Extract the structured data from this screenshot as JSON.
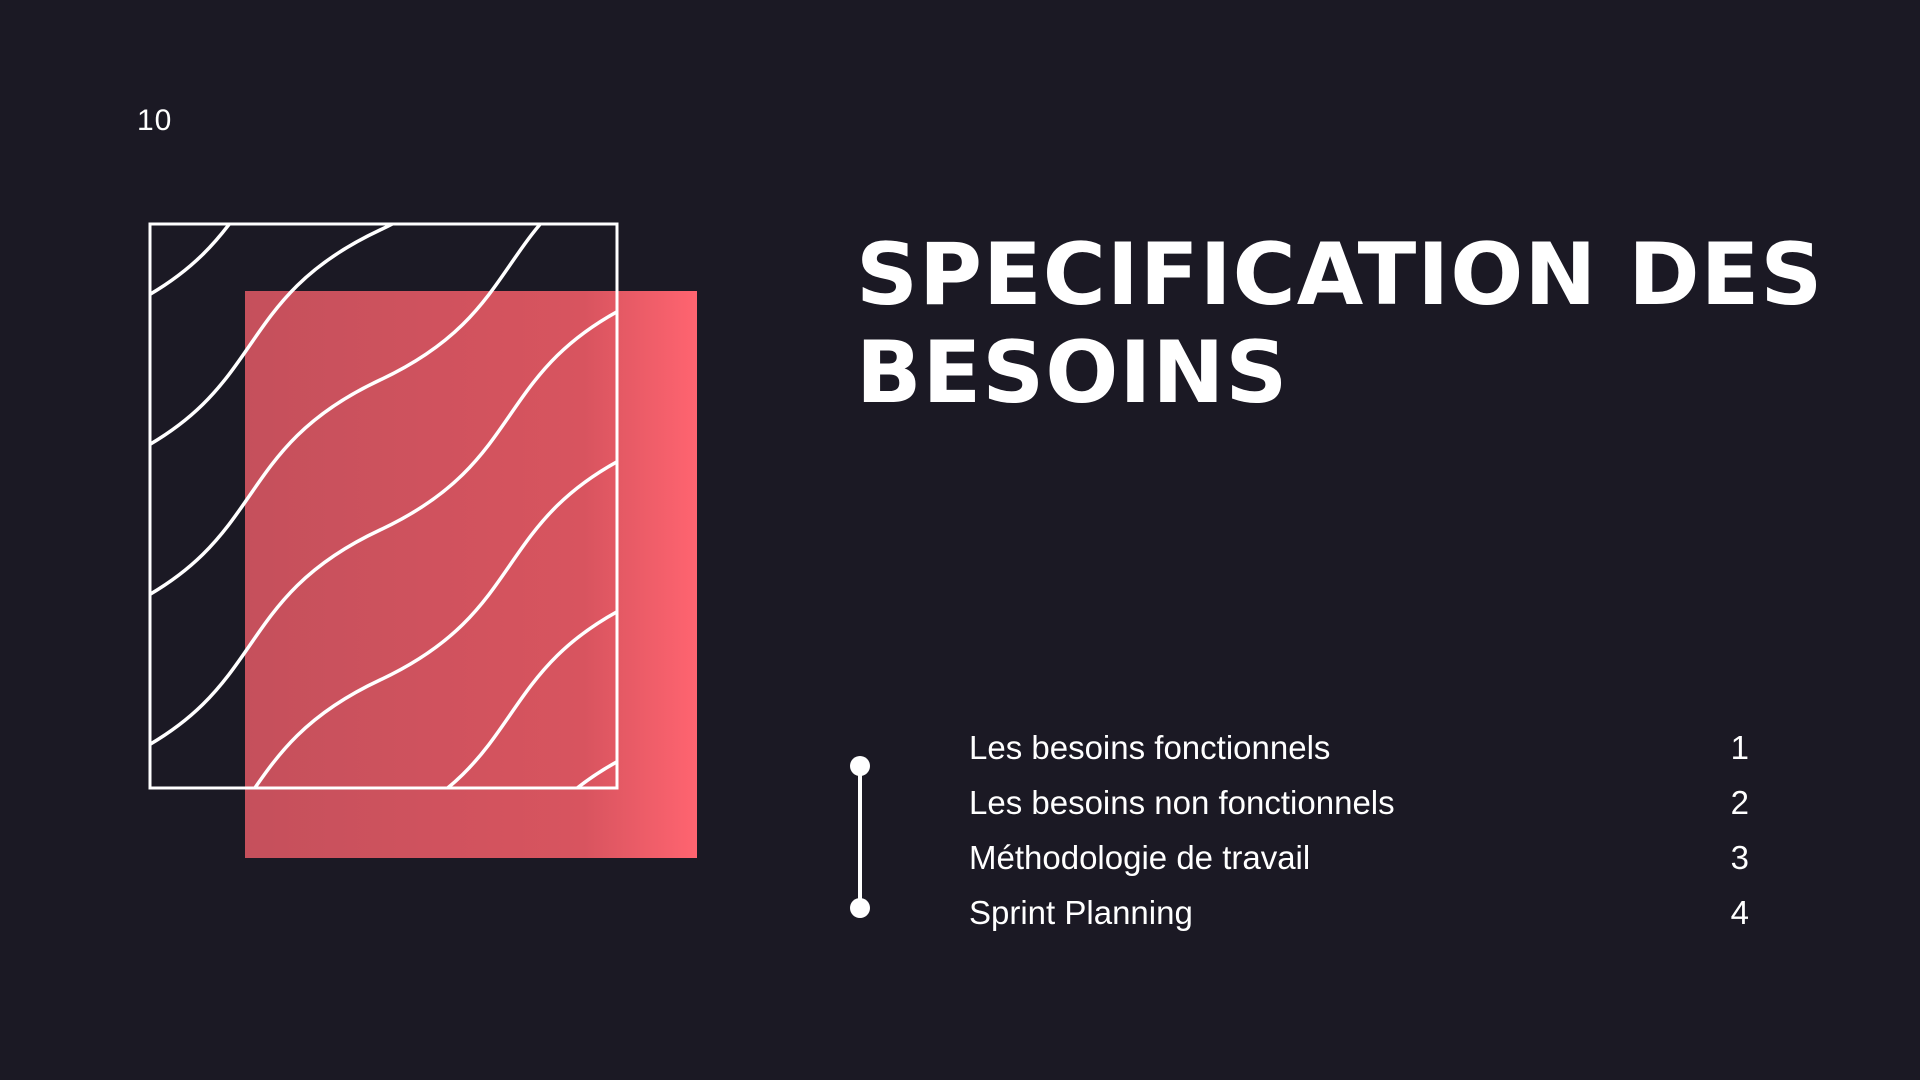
{
  "page_number": "10",
  "title": "SPECIFICATION DES BESOINS",
  "toc": [
    {
      "label": "Les besoins fonctionnels",
      "number": "1"
    },
    {
      "label": "Les besoins non fonctionnels",
      "number": "2"
    },
    {
      "label": "Méthodologie de travail",
      "number": "3"
    },
    {
      "label": "Sprint Planning",
      "number": "4"
    }
  ],
  "colors": {
    "background": "#1b1924",
    "accent": "#ff5f6d",
    "accent_dark": "#c8505c",
    "line": "#ffffff"
  }
}
